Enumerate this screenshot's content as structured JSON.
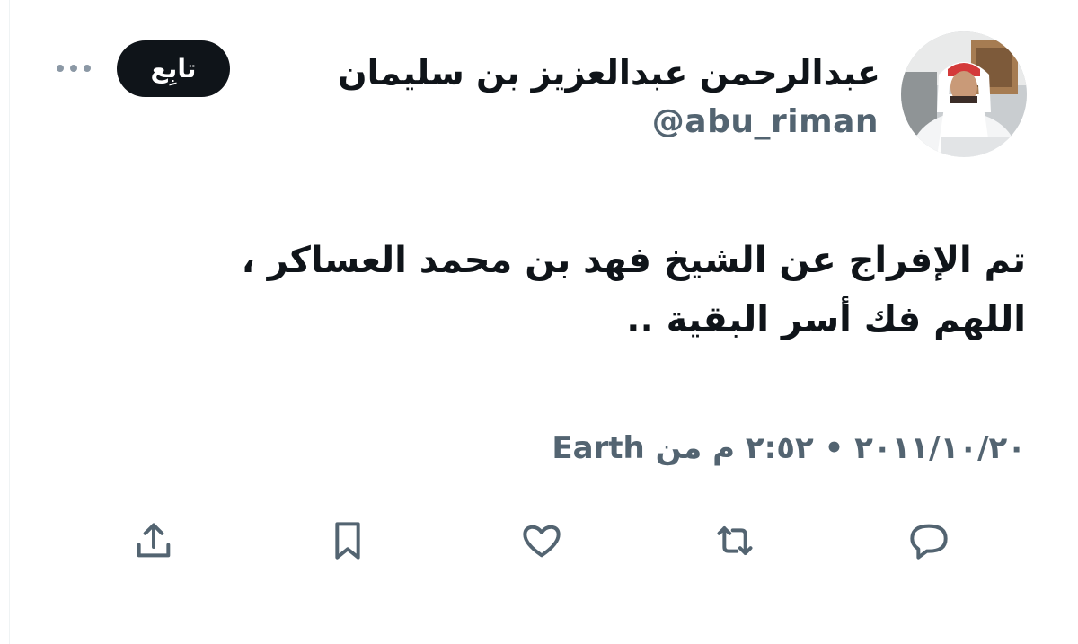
{
  "author": {
    "display_name": "عبدالرحمن عبدالعزيز بن سليمان",
    "handle": "@abu_riman",
    "avatar_icon": "profile-photo"
  },
  "follow_button": {
    "label": "تابِع"
  },
  "more_icon": "more-horizontal-icon",
  "tweet": {
    "lines": [
      "تم الإفراج عن الشيخ فهد بن محمد العساكر ،",
      "اللهم فك أسر البقية .."
    ]
  },
  "meta": {
    "date": "٢٠١١/١٠/٢٠",
    "separator": "•",
    "time": "٢:٥٢ م",
    "source_prefix": "من",
    "source": "Earth"
  },
  "actions": [
    {
      "name": "reply",
      "icon": "reply-icon"
    },
    {
      "name": "retweet",
      "icon": "retweet-icon"
    },
    {
      "name": "like",
      "icon": "heart-icon"
    },
    {
      "name": "bookmark",
      "icon": "bookmark-icon"
    },
    {
      "name": "share",
      "icon": "share-icon"
    }
  ],
  "colors": {
    "text_primary": "#0f1419",
    "text_secondary": "#536471",
    "button_bg": "#0f1419",
    "button_text": "#ffffff"
  }
}
